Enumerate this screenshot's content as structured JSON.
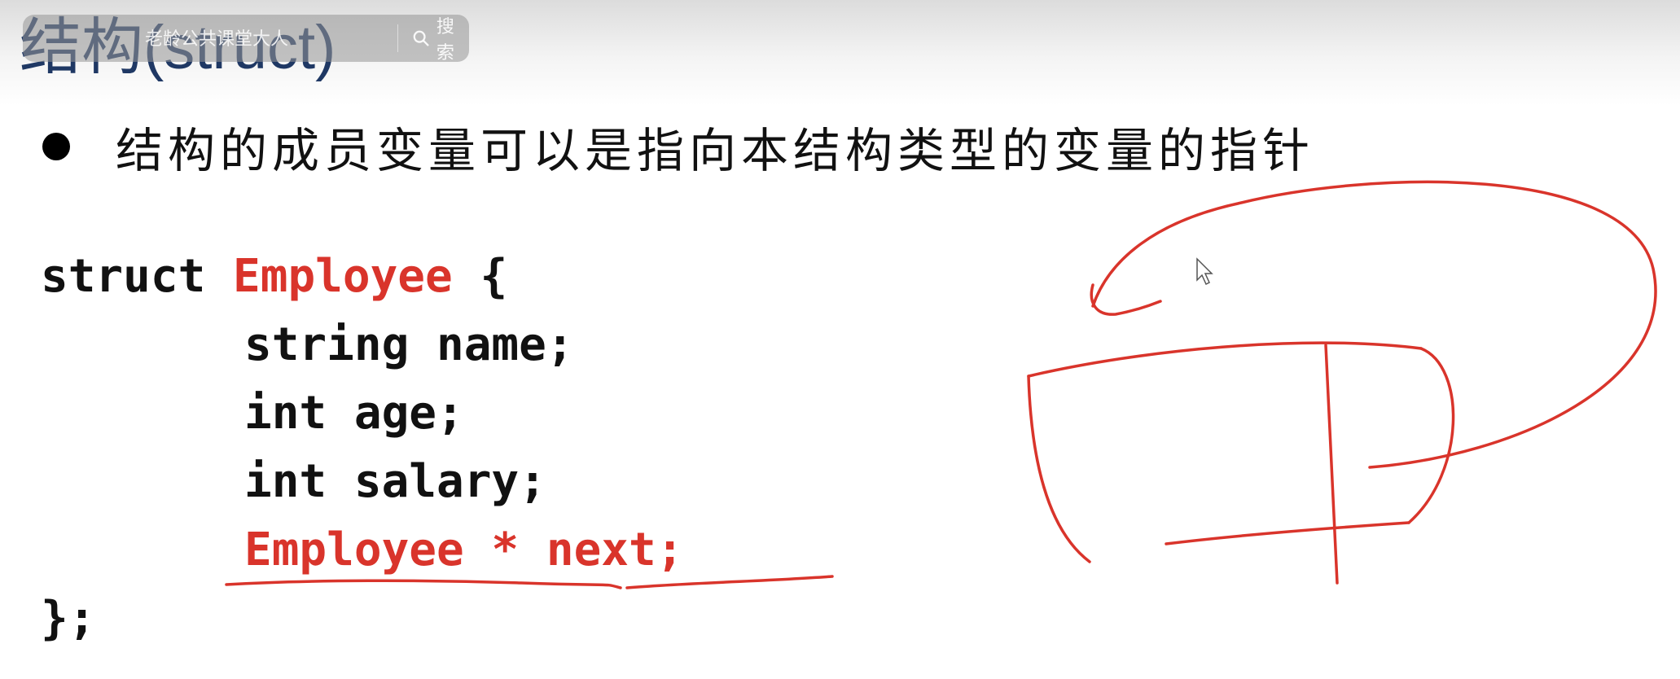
{
  "slide": {
    "title": "结构(struct)",
    "bullet": "结构的成员变量可以是指向本结构类型的变量的指针"
  },
  "overlay": {
    "search_text": "老龄公共课堂大人",
    "search_button": "搜索",
    "search_icon": "magnifier-icon"
  },
  "code": {
    "line1_kw": "struct",
    "line1_name": "Employee",
    "line1_brace": "{",
    "line2": "string name;",
    "line3": "int age;",
    "line4": "int salary;",
    "line5": "Employee * next;",
    "line6": "};"
  },
  "colors": {
    "title": "#1f3864",
    "highlight": "#d9342b",
    "annotation": "#d9342b"
  }
}
